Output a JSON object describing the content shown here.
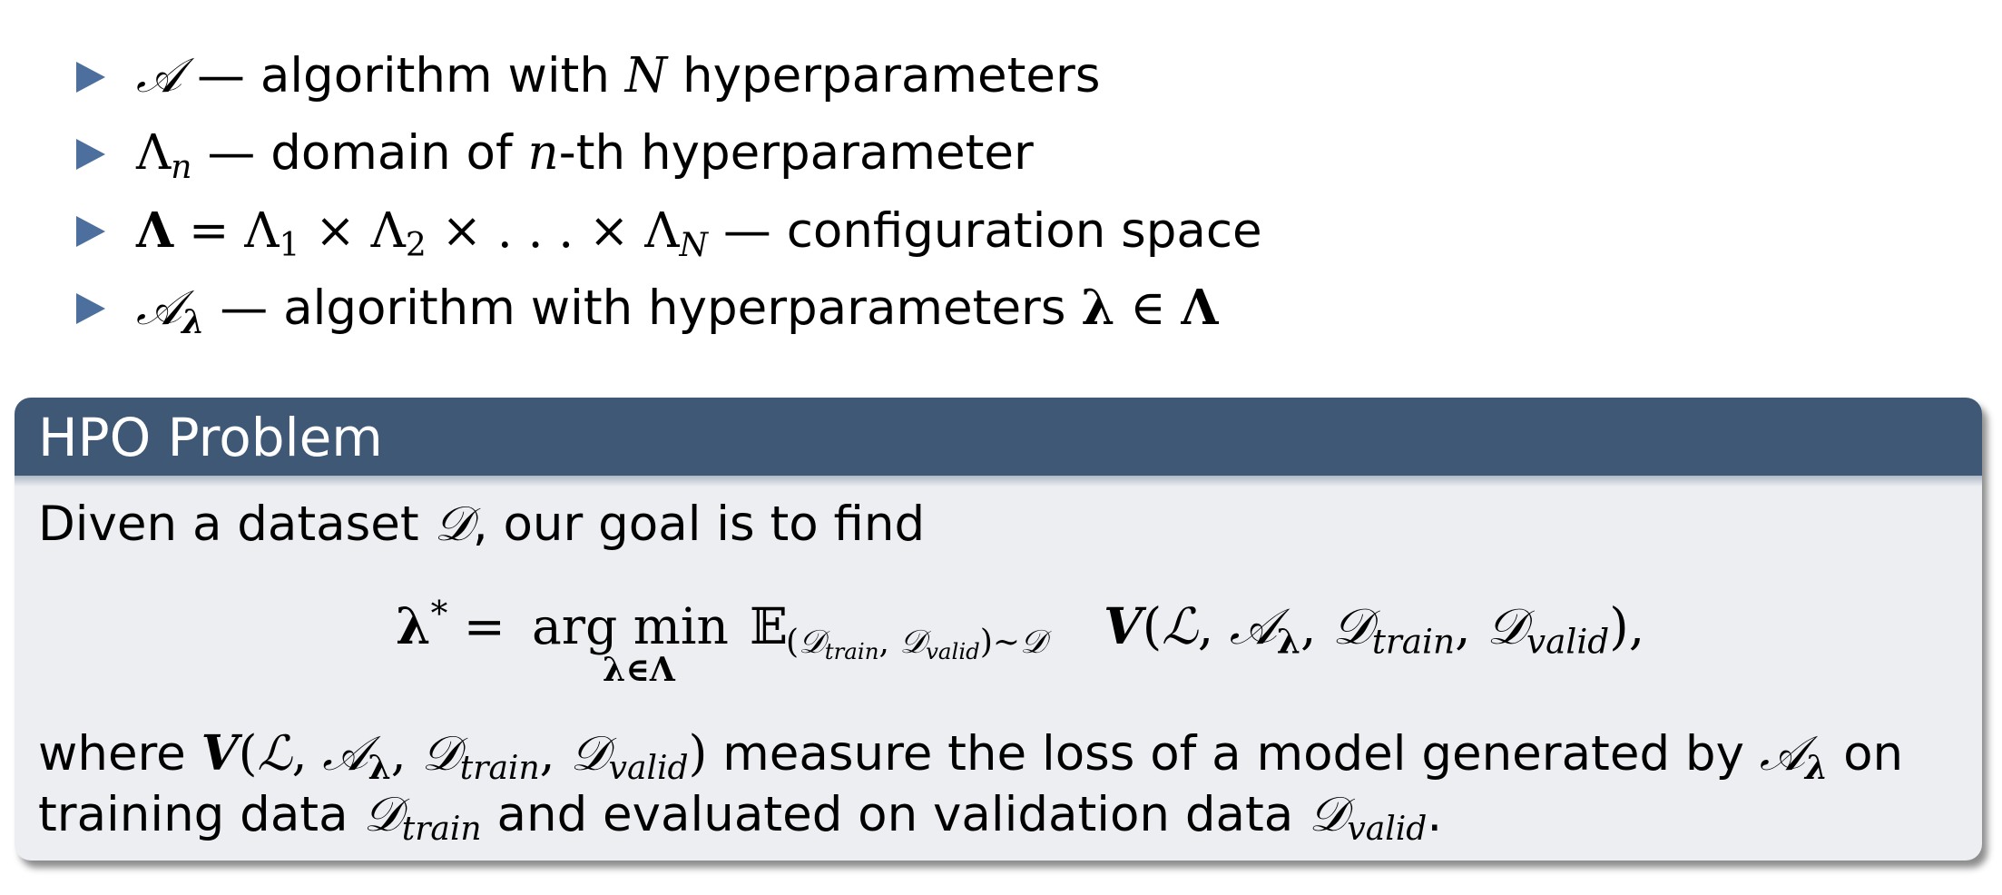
{
  "bullets": [
    {
      "text": "— algorithm with",
      "text2": "hyperparameters"
    },
    {
      "text": "— domain of",
      "text2": "-th hyperparameter"
    },
    {
      "text": "— configuration space"
    },
    {
      "text": "— algorithm with hyperparameters"
    }
  ],
  "math_symbols": {
    "A": "𝒜",
    "N": "N",
    "Lambda": "Λ",
    "n": "n",
    "D": "𝒟",
    "L": "ℒ",
    "lambda_bold": "λ",
    "Lambda_bold": "Λ",
    "V": "V",
    "E": "𝔼"
  },
  "block": {
    "title": "HPO Problem",
    "intro_a": "Diven a dataset",
    "intro_b": ", our goal is to find",
    "where": "where",
    "measure": "measure the loss of a model generated by",
    "on": "on",
    "training_data": "training data",
    "evaluated": "and evaluated on validation data",
    "period": ".",
    "sub_train": "train",
    "sub_valid": "valid",
    "argmin": "arg min",
    "argmin_under": "λ∈Λ"
  },
  "colors": {
    "bullet_triangle": "#4d6f9e",
    "block_header": "#3f5876",
    "block_body": "#eceef2"
  }
}
